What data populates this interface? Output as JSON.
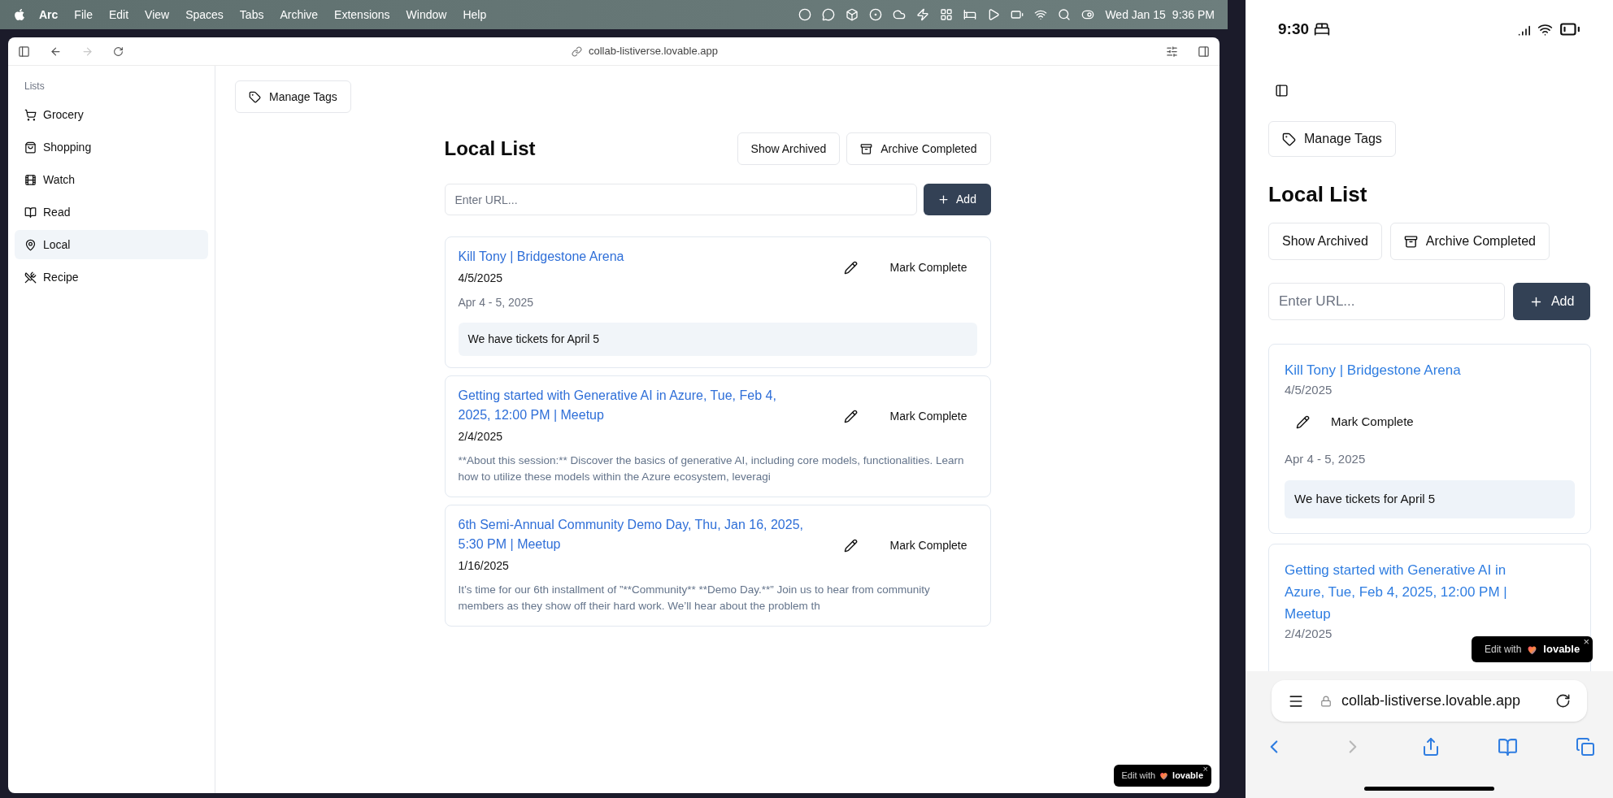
{
  "menu_bar": {
    "app": "Arc",
    "items": [
      "File",
      "Edit",
      "View",
      "Spaces",
      "Tabs",
      "Archive",
      "Extensions",
      "Window",
      "Help"
    ],
    "date": "Wed Jan 15",
    "time": "9:36 PM"
  },
  "browser": {
    "url": "collab-listiverse.lovable.app",
    "nav": [
      {
        "kind": "back",
        "disabled": false
      },
      {
        "kind": "forward",
        "disabled": true
      },
      {
        "kind": "reload",
        "disabled": false
      }
    ]
  },
  "sidebar": {
    "heading": "Lists",
    "items": [
      {
        "label": "Grocery",
        "selected": false
      },
      {
        "label": "Shopping",
        "selected": false
      },
      {
        "label": "Watch",
        "selected": false
      },
      {
        "label": "Read",
        "selected": false
      },
      {
        "label": "Local",
        "selected": true
      },
      {
        "label": "Recipe",
        "selected": false
      }
    ]
  },
  "main": {
    "manage_tags": "Manage Tags",
    "title": "Local List",
    "show_archived": "Show Archived",
    "archive_completed": "Archive Completed",
    "url_placeholder": "Enter URL...",
    "add": "Add",
    "items": [
      {
        "title": "Kill Tony | Bridgestone Arena",
        "date": "4/5/2025",
        "action": "Mark Complete",
        "date_range": "Apr 4 - 5, 2025",
        "note": "We have tickets for April 5"
      },
      {
        "title": "Getting started with Generative AI in Azure, Tue, Feb 4, 2025, 12:00 PM | Meetup",
        "date": "2/4/2025",
        "action": "Mark Complete",
        "description": "**About this session:** Discover the basics of generative AI, including core models, functionalities. Learn how to utilize these models within the Azure ecosystem, leveragi"
      },
      {
        "title": "6th Semi-Annual Community Demo Day, Thu, Jan 16, 2025, 5:30 PM | Meetup",
        "date": "1/16/2025",
        "action": "Mark Complete",
        "description": "It’s time for our 6th installment of ”**Community** **Demo Day.**” Join us to hear from community members as they show off their hard work. We’ll hear about the problem th"
      }
    ]
  },
  "badge": {
    "prefix": "Edit with",
    "brand": "lovable",
    "close": "×"
  },
  "phone": {
    "time": "9:30",
    "manage_tags": "Manage Tags",
    "title": "Local List",
    "show_archived": "Show Archived",
    "archive_completed": "Archive Completed",
    "url_placeholder": "Enter URL...",
    "add": "Add",
    "items": [
      {
        "title": "Kill Tony | Bridgestone Arena",
        "date": "4/5/2025",
        "action": "Mark Complete",
        "date_range": "Apr 4 - 5, 2025",
        "note": "We have tickets for April 5"
      },
      {
        "title": "Getting started with Generative AI in Azure, Tue, Feb 4, 2025, 12:00 PM | Meetup",
        "date": "2/4/2025"
      }
    ],
    "badge": {
      "prefix": "Edit with",
      "brand": "lovable",
      "close": "×"
    },
    "url": "collab-listiverse.lovable.app",
    "nav": [
      {
        "kind": "back",
        "disabled": false
      },
      {
        "kind": "forward",
        "disabled": true
      }
    ]
  }
}
